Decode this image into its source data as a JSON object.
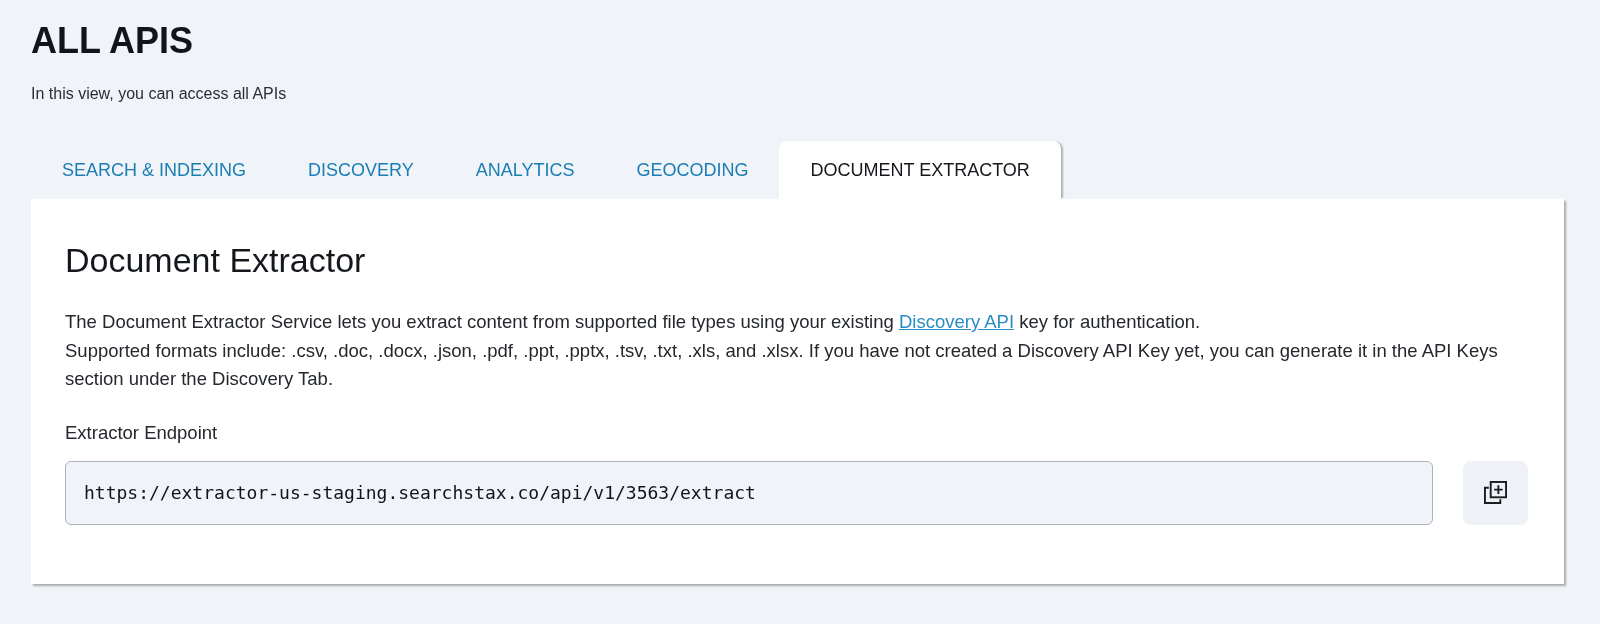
{
  "page": {
    "title": "ALL APIS",
    "subtitle": "In this view, you can access all APIs"
  },
  "tabs": [
    {
      "label": "SEARCH & INDEXING",
      "selected": false
    },
    {
      "label": "DISCOVERY",
      "selected": false
    },
    {
      "label": "ANALYTICS",
      "selected": false
    },
    {
      "label": "GEOCODING",
      "selected": false
    },
    {
      "label": "DOCUMENT EXTRACTOR",
      "selected": true
    }
  ],
  "panel": {
    "heading": "Document Extractor",
    "intro": {
      "before": "The Document Extractor Service lets you extract content from supported file types using your existing ",
      "link": "Discovery API",
      "after": " key for authentication."
    },
    "formats_note": "Supported formats include: .csv, .doc, .docx, .json, .pdf, .ppt, .pptx, .tsv, .txt, .xls, and .xlsx. If you have not created a Discovery API Key yet, you can generate it in the API Keys section under the Discovery Tab.",
    "endpoint": {
      "label": "Extractor Endpoint",
      "value": "https://extractor-us-staging.searchstax.co/api/v1/3563/extract"
    }
  }
}
